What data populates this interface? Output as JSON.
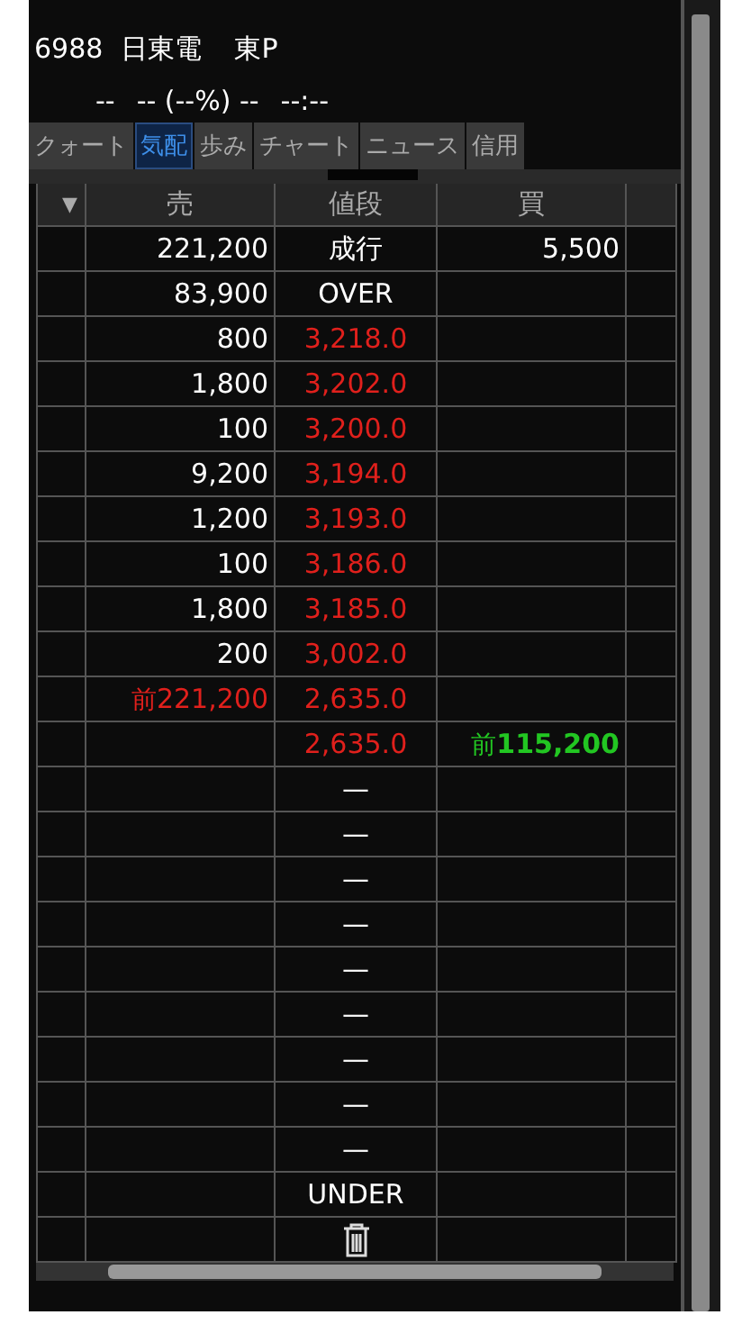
{
  "header": {
    "code": "6988",
    "name": "日東電",
    "market": "東P",
    "last": "--",
    "change": "-- (--%) --",
    "time": "--:--"
  },
  "tabs": [
    {
      "label": "クォート",
      "selected": false
    },
    {
      "label": "気配",
      "selected": true
    },
    {
      "label": "歩み",
      "selected": false
    },
    {
      "label": "チャート",
      "selected": false
    },
    {
      "label": "ニュース",
      "selected": false
    },
    {
      "label": "信用",
      "selected": false
    }
  ],
  "table": {
    "columns": [
      {
        "label": "▼"
      },
      {
        "label": "売"
      },
      {
        "label": "値段"
      },
      {
        "label": "買"
      },
      {}
    ],
    "rows": [
      {
        "sell": {
          "text": "221,200",
          "color": "#ffffff"
        },
        "price": {
          "text": "成行",
          "color": "#ffffff"
        },
        "buy": {
          "text": "5,500",
          "color": "#ffffff"
        }
      },
      {
        "sell": {
          "text": "83,900",
          "color": "#ffffff"
        },
        "price": {
          "text": "OVER",
          "color": "#ffffff"
        }
      },
      {
        "sell": {
          "text": "800",
          "color": "#ffffff"
        },
        "price": {
          "text": "3,218.0",
          "color": "#e0201c"
        }
      },
      {
        "sell": {
          "text": "1,800",
          "color": "#ffffff"
        },
        "price": {
          "text": "3,202.0",
          "color": "#e0201c"
        }
      },
      {
        "sell": {
          "text": "100",
          "color": "#ffffff"
        },
        "price": {
          "text": "3,200.0",
          "color": "#e0201c"
        }
      },
      {
        "sell": {
          "text": "9,200",
          "color": "#ffffff"
        },
        "price": {
          "text": "3,194.0",
          "color": "#e0201c"
        }
      },
      {
        "sell": {
          "text": "1,200",
          "color": "#ffffff"
        },
        "price": {
          "text": "3,193.0",
          "color": "#e0201c"
        }
      },
      {
        "sell": {
          "text": "100",
          "color": "#ffffff"
        },
        "price": {
          "text": "3,186.0",
          "color": "#e0201c"
        }
      },
      {
        "sell": {
          "text": "1,800",
          "color": "#ffffff"
        },
        "price": {
          "text": "3,185.0",
          "color": "#e0201c"
        }
      },
      {
        "sell": {
          "text": "200",
          "color": "#ffffff"
        },
        "price": {
          "text": "3,002.0",
          "color": "#e0201c"
        }
      },
      {
        "sell": {
          "prefix": "前",
          "text": "221,200",
          "color": "#e0201c"
        },
        "price": {
          "text": "2,635.0",
          "color": "#e0201c"
        }
      },
      {
        "price": {
          "text": "2,635.0",
          "color": "#e0201c"
        },
        "buy": {
          "prefix": "前",
          "text": "115,200",
          "color": "#22c622"
        }
      },
      {
        "price": {
          "text": "—",
          "color": "#ffffff"
        }
      },
      {
        "price": {
          "text": "—",
          "color": "#ffffff"
        }
      },
      {
        "price": {
          "text": "—",
          "color": "#ffffff"
        }
      },
      {
        "price": {
          "text": "—",
          "color": "#ffffff"
        }
      },
      {
        "price": {
          "text": "—",
          "color": "#ffffff"
        }
      },
      {
        "price": {
          "text": "—",
          "color": "#ffffff"
        }
      },
      {
        "price": {
          "text": "—",
          "color": "#ffffff"
        }
      },
      {
        "price": {
          "text": "—",
          "color": "#ffffff"
        }
      },
      {
        "price": {
          "text": "—",
          "color": "#ffffff"
        }
      },
      {
        "price": {
          "text": "UNDER",
          "color": "#ffffff"
        }
      },
      {
        "kind": "trash"
      }
    ]
  }
}
